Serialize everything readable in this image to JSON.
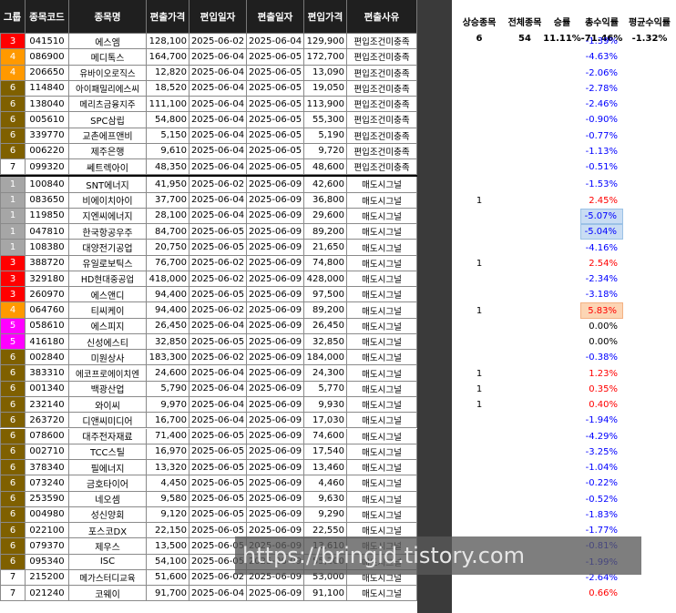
{
  "columns": [
    "그룹",
    "종목코드",
    "종목명",
    "편출가격",
    "편입일자",
    "편출일자",
    "편입가격",
    "편출사유"
  ],
  "summary": {
    "headers": [
      "상승종목",
      "전체종목",
      "승률",
      "총수익률",
      "평균수익률"
    ],
    "values": [
      "6",
      "54",
      "11.11%",
      "-71.46%",
      "-1.32%"
    ]
  },
  "colors": {
    "group_1": "#a6a6a6",
    "group_3": "#ff0000",
    "group_4": "#ff9900",
    "group_5": "#ff00ff",
    "group_6": "#7f6000",
    "group_7": "#ffffff",
    "positive": "#ff0000",
    "negative": "#0000ff",
    "neutral": "#000000",
    "highlight_blue": "#c9ddf3",
    "highlight_orange": "#fcd5b4"
  },
  "rows": [
    {
      "group": "3",
      "code": "041510",
      "name": "에스엠",
      "exit_price": "128,100",
      "entry_date": "2025-06-02",
      "exit_date": "2025-06-04",
      "entry_price": "129,900",
      "reason": "편입조건미충족",
      "up": "",
      "ret": "-1.39%"
    },
    {
      "group": "4",
      "code": "086900",
      "name": "메디톡스",
      "exit_price": "164,700",
      "entry_date": "2025-06-04",
      "exit_date": "2025-06-05",
      "entry_price": "172,700",
      "reason": "편입조건미충족",
      "up": "",
      "ret": "-4.63%"
    },
    {
      "group": "4",
      "code": "206650",
      "name": "유바이오로직스",
      "exit_price": "12,820",
      "entry_date": "2025-06-04",
      "exit_date": "2025-06-05",
      "entry_price": "13,090",
      "reason": "편입조건미충족",
      "up": "",
      "ret": "-2.06%"
    },
    {
      "group": "6",
      "code": "114840",
      "name": "아이패밀리에스씨",
      "exit_price": "18,520",
      "entry_date": "2025-06-04",
      "exit_date": "2025-06-05",
      "entry_price": "19,050",
      "reason": "편입조건미충족",
      "up": "",
      "ret": "-2.78%"
    },
    {
      "group": "6",
      "code": "138040",
      "name": "메리츠금융지주",
      "exit_price": "111,100",
      "entry_date": "2025-06-04",
      "exit_date": "2025-06-05",
      "entry_price": "113,900",
      "reason": "편입조건미충족",
      "up": "",
      "ret": "-2.46%"
    },
    {
      "group": "6",
      "code": "005610",
      "name": "SPC삼립",
      "exit_price": "54,800",
      "entry_date": "2025-06-04",
      "exit_date": "2025-06-05",
      "entry_price": "55,300",
      "reason": "편입조건미충족",
      "up": "",
      "ret": "-0.90%"
    },
    {
      "group": "6",
      "code": "339770",
      "name": "교촌에프앤비",
      "exit_price": "5,150",
      "entry_date": "2025-06-04",
      "exit_date": "2025-06-05",
      "entry_price": "5,190",
      "reason": "편입조건미충족",
      "up": "",
      "ret": "-0.77%"
    },
    {
      "group": "6",
      "code": "006220",
      "name": "제주은행",
      "exit_price": "9,610",
      "entry_date": "2025-06-04",
      "exit_date": "2025-06-05",
      "entry_price": "9,720",
      "reason": "편입조건미충족",
      "up": "",
      "ret": "-1.13%"
    },
    {
      "group": "7",
      "code": "099320",
      "name": "쎄트렉아이",
      "exit_price": "48,350",
      "entry_date": "2025-06-04",
      "exit_date": "2025-06-05",
      "entry_price": "48,600",
      "reason": "편입조건미충족",
      "up": "",
      "ret": "-0.51%"
    },
    {
      "group": "1",
      "code": "100840",
      "name": "SNT에너지",
      "exit_price": "41,950",
      "entry_date": "2025-06-02",
      "exit_date": "2025-06-09",
      "entry_price": "42,600",
      "reason": "매도시그널",
      "up": "",
      "ret": "-1.53%"
    },
    {
      "group": "1",
      "code": "083650",
      "name": "비에이치아이",
      "exit_price": "37,700",
      "entry_date": "2025-06-04",
      "exit_date": "2025-06-09",
      "entry_price": "36,800",
      "reason": "매도시그널",
      "up": "1",
      "ret": "2.45%"
    },
    {
      "group": "1",
      "code": "119850",
      "name": "지엔씨에너지",
      "exit_price": "28,100",
      "entry_date": "2025-06-04",
      "exit_date": "2025-06-09",
      "entry_price": "29,600",
      "reason": "매도시그널",
      "up": "",
      "ret": "-5.07%",
      "hl": "blue"
    },
    {
      "group": "1",
      "code": "047810",
      "name": "한국항공우주",
      "exit_price": "84,700",
      "entry_date": "2025-06-05",
      "exit_date": "2025-06-09",
      "entry_price": "89,200",
      "reason": "매도시그널",
      "up": "",
      "ret": "-5.04%",
      "hl": "blue"
    },
    {
      "group": "1",
      "code": "108380",
      "name": "대양전기공업",
      "exit_price": "20,750",
      "entry_date": "2025-06-05",
      "exit_date": "2025-06-09",
      "entry_price": "21,650",
      "reason": "매도시그널",
      "up": "",
      "ret": "-4.16%"
    },
    {
      "group": "3",
      "code": "388720",
      "name": "유일로보틱스",
      "exit_price": "76,700",
      "entry_date": "2025-06-02",
      "exit_date": "2025-06-09",
      "entry_price": "74,800",
      "reason": "매도시그널",
      "up": "1",
      "ret": "2.54%"
    },
    {
      "group": "3",
      "code": "329180",
      "name": "HD현대중공업",
      "exit_price": "418,000",
      "entry_date": "2025-06-02",
      "exit_date": "2025-06-09",
      "entry_price": "428,000",
      "reason": "매도시그널",
      "up": "",
      "ret": "-2.34%"
    },
    {
      "group": "3",
      "code": "260970",
      "name": "에스앤디",
      "exit_price": "94,400",
      "entry_date": "2025-06-05",
      "exit_date": "2025-06-09",
      "entry_price": "97,500",
      "reason": "매도시그널",
      "up": "",
      "ret": "-3.18%"
    },
    {
      "group": "4",
      "code": "064760",
      "name": "티씨케이",
      "exit_price": "94,400",
      "entry_date": "2025-06-02",
      "exit_date": "2025-06-09",
      "entry_price": "89,200",
      "reason": "매도시그널",
      "up": "1",
      "ret": "5.83%",
      "hl": "orange"
    },
    {
      "group": "5",
      "code": "058610",
      "name": "에스피지",
      "exit_price": "26,450",
      "entry_date": "2025-06-04",
      "exit_date": "2025-06-09",
      "entry_price": "26,450",
      "reason": "매도시그널",
      "up": "",
      "ret": "0.00%"
    },
    {
      "group": "5",
      "code": "416180",
      "name": "신성에스티",
      "exit_price": "32,850",
      "entry_date": "2025-06-05",
      "exit_date": "2025-06-09",
      "entry_price": "32,850",
      "reason": "매도시그널",
      "up": "",
      "ret": "0.00%"
    },
    {
      "group": "6",
      "code": "002840",
      "name": "미원상사",
      "exit_price": "183,300",
      "entry_date": "2025-06-02",
      "exit_date": "2025-06-09",
      "entry_price": "184,000",
      "reason": "매도시그널",
      "up": "",
      "ret": "-0.38%"
    },
    {
      "group": "6",
      "code": "383310",
      "name": "에코프로에이치엔",
      "exit_price": "24,600",
      "entry_date": "2025-06-04",
      "exit_date": "2025-06-09",
      "entry_price": "24,300",
      "reason": "매도시그널",
      "up": "1",
      "ret": "1.23%"
    },
    {
      "group": "6",
      "code": "001340",
      "name": "백광산업",
      "exit_price": "5,790",
      "entry_date": "2025-06-04",
      "exit_date": "2025-06-09",
      "entry_price": "5,770",
      "reason": "매도시그널",
      "up": "1",
      "ret": "0.35%"
    },
    {
      "group": "6",
      "code": "232140",
      "name": "와이씨",
      "exit_price": "9,970",
      "entry_date": "2025-06-04",
      "exit_date": "2025-06-09",
      "entry_price": "9,930",
      "reason": "매도시그널",
      "up": "1",
      "ret": "0.40%"
    },
    {
      "group": "6",
      "code": "263720",
      "name": "디앤씨미디어",
      "exit_price": "16,700",
      "entry_date": "2025-06-04",
      "exit_date": "2025-06-09",
      "entry_price": "17,030",
      "reason": "매도시그널",
      "up": "",
      "ret": "-1.94%"
    },
    {
      "group": "6",
      "code": "078600",
      "name": "대주전자재료",
      "exit_price": "71,400",
      "entry_date": "2025-06-05",
      "exit_date": "2025-06-09",
      "entry_price": "74,600",
      "reason": "매도시그널",
      "up": "",
      "ret": "-4.29%"
    },
    {
      "group": "6",
      "code": "002710",
      "name": "TCC스틸",
      "exit_price": "16,970",
      "entry_date": "2025-06-05",
      "exit_date": "2025-06-09",
      "entry_price": "17,540",
      "reason": "매도시그널",
      "up": "",
      "ret": "-3.25%"
    },
    {
      "group": "6",
      "code": "378340",
      "name": "필에너지",
      "exit_price": "13,320",
      "entry_date": "2025-06-05",
      "exit_date": "2025-06-09",
      "entry_price": "13,460",
      "reason": "매도시그널",
      "up": "",
      "ret": "-1.04%"
    },
    {
      "group": "6",
      "code": "073240",
      "name": "금호타이어",
      "exit_price": "4,450",
      "entry_date": "2025-06-05",
      "exit_date": "2025-06-09",
      "entry_price": "4,460",
      "reason": "매도시그널",
      "up": "",
      "ret": "-0.22%"
    },
    {
      "group": "6",
      "code": "253590",
      "name": "네오셈",
      "exit_price": "9,580",
      "entry_date": "2025-06-05",
      "exit_date": "2025-06-09",
      "entry_price": "9,630",
      "reason": "매도시그널",
      "up": "",
      "ret": "-0.52%"
    },
    {
      "group": "6",
      "code": "004980",
      "name": "성신양회",
      "exit_price": "9,120",
      "entry_date": "2025-06-05",
      "exit_date": "2025-06-09",
      "entry_price": "9,290",
      "reason": "매도시그널",
      "up": "",
      "ret": "-1.83%"
    },
    {
      "group": "6",
      "code": "022100",
      "name": "포스코DX",
      "exit_price": "22,150",
      "entry_date": "2025-06-05",
      "exit_date": "2025-06-09",
      "entry_price": "22,550",
      "reason": "매도시그널",
      "up": "",
      "ret": "-1.77%"
    },
    {
      "group": "6",
      "code": "079370",
      "name": "제우스",
      "exit_price": "13,500",
      "entry_date": "2025-06-05",
      "exit_date": "2025-06-09",
      "entry_price": "13,610",
      "reason": "매도시그널",
      "up": "",
      "ret": "-0.81%"
    },
    {
      "group": "6",
      "code": "095340",
      "name": "ISC",
      "exit_price": "54,100",
      "entry_date": "2025-06-05",
      "exit_date": "2025-06-09",
      "entry_price": "55,200",
      "reason": "매도시그널",
      "up": "",
      "ret": "-1.99%"
    },
    {
      "group": "7",
      "code": "215200",
      "name": "메가스터디교육",
      "exit_price": "51,600",
      "entry_date": "2025-06-02",
      "exit_date": "2025-06-09",
      "entry_price": "53,000",
      "reason": "매도시그널",
      "up": "",
      "ret": "-2.64%"
    },
    {
      "group": "7",
      "code": "021240",
      "name": "코웨이",
      "exit_price": "91,700",
      "entry_date": "2025-06-04",
      "exit_date": "2025-06-09",
      "entry_price": "91,100",
      "reason": "매도시그널",
      "up": "",
      "ret": "0.66%"
    }
  ],
  "watermark": "https://bringid.tistory.com"
}
